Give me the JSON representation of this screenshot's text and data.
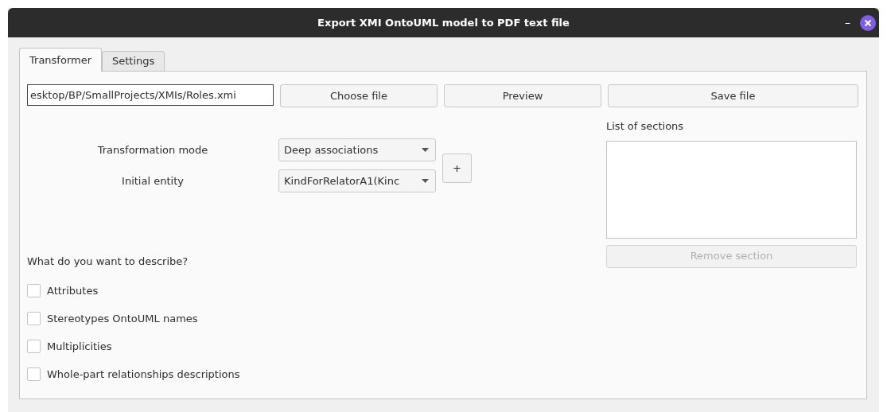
{
  "window": {
    "title": "Export XMI OntoUML model to PDF text file",
    "minimize": "–"
  },
  "tabs": [
    {
      "label": "Transformer",
      "selected": true
    },
    {
      "label": "Settings",
      "selected": false
    }
  ],
  "file_path": {
    "value": "esktop/BP/SmallProjects/XMIs/Roles.xmi"
  },
  "buttons": [
    {
      "label": "Choose file"
    },
    {
      "label": "Preview"
    },
    {
      "label": "Save file"
    }
  ],
  "form": [
    {
      "label": "Transformation mode",
      "value": "Deep associations"
    },
    {
      "label": "Initial entity",
      "value": "KindForRelatorA1(Kinc"
    }
  ],
  "add_button": "+",
  "sections": {
    "label": "List of sections",
    "remove_button": {
      "label": "Remove section",
      "disabled": true
    }
  },
  "describe": {
    "label": "What do you want to describe?",
    "options": [
      {
        "label": "Attributes",
        "checked": false
      },
      {
        "label": "Stereotypes OntoUML names",
        "checked": false
      },
      {
        "label": "Multiplicities",
        "checked": false
      },
      {
        "label": "Whole-part relationships descriptions",
        "checked": false
      }
    ]
  }
}
